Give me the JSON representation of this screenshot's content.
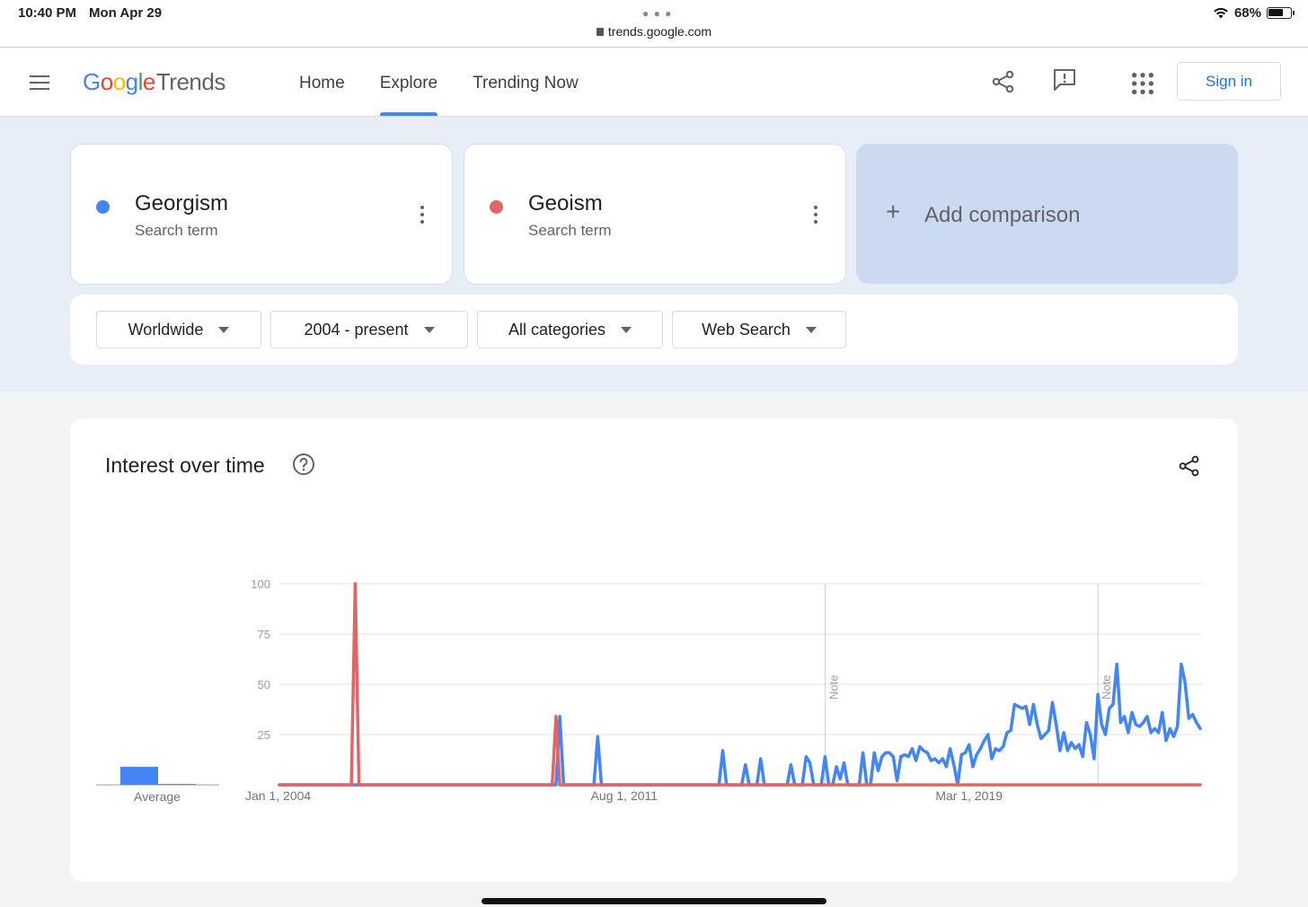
{
  "status_bar": {
    "time": "10:40 PM",
    "date": "Mon Apr 29",
    "url": "trends.google.com",
    "battery": "68%",
    "battery_level": 0.68,
    "icons": [
      "wifi-icon",
      "battery-icon",
      "lock-icon"
    ]
  },
  "header": {
    "logo_google": [
      "G",
      "o",
      "o",
      "g",
      "l",
      "e"
    ],
    "logo_colors": [
      "#4285f4",
      "#ea4335",
      "#fbbc05",
      "#4285f4",
      "#34a853",
      "#ea4335"
    ],
    "logo_trends": "Trends",
    "nav": [
      {
        "label": "Home",
        "active": false
      },
      {
        "label": "Explore",
        "active": true
      },
      {
        "label": "Trending Now",
        "active": false
      }
    ],
    "icons": [
      "menu-icon",
      "share-icon",
      "feedback-icon",
      "apps-grid-icon"
    ],
    "sign_in": "Sign in"
  },
  "terms": [
    {
      "name": "Georgism",
      "sub": "Search term",
      "color": "#4285f4"
    },
    {
      "name": "Geoism",
      "sub": "Search term",
      "color": "#e06666"
    }
  ],
  "add_comparison": {
    "plus": "+",
    "label": "Add comparison"
  },
  "filters": [
    {
      "label": "Worldwide"
    },
    {
      "label": "2004 - present"
    },
    {
      "label": "All categories"
    },
    {
      "label": "Web Search"
    }
  ],
  "interest_over_time": {
    "title": "Interest over time",
    "icons": [
      "help-icon",
      "share-icon"
    ]
  },
  "chart_data": {
    "type": "line",
    "title": "Interest over time",
    "ylim": [
      0,
      100
    ],
    "y_ticks": [
      "100",
      "75",
      "50",
      "25"
    ],
    "x_ticks": [
      "Jan 1, 2004",
      "Aug 1, 2011",
      "Mar 1, 2019"
    ],
    "x_range": [
      "2004-01",
      "2024-04"
    ],
    "notes": [
      {
        "date": "2016-01",
        "label": "Note"
      },
      {
        "date": "2022-01",
        "label": "Note"
      }
    ],
    "average_label": "Average",
    "averages": [
      {
        "name": "Georgism",
        "value": 9,
        "color": "#4285f4"
      },
      {
        "name": "Geoism",
        "value": 0.5,
        "color": "#e06666"
      }
    ],
    "grid": true,
    "series": [
      {
        "name": "Georgism",
        "color": "#4285f4",
        "points": [
          [
            "2004-01",
            0
          ],
          [
            "2010-02",
            0
          ],
          [
            "2010-03",
            34
          ],
          [
            "2010-04",
            0
          ],
          [
            "2010-12",
            0
          ],
          [
            "2011-01",
            24
          ],
          [
            "2011-02",
            0
          ],
          [
            "2013-09",
            0
          ],
          [
            "2013-10",
            17
          ],
          [
            "2013-11",
            0
          ],
          [
            "2014-03",
            0
          ],
          [
            "2014-04",
            10
          ],
          [
            "2014-05",
            0
          ],
          [
            "2014-07",
            0
          ],
          [
            "2014-08",
            13
          ],
          [
            "2014-09",
            0
          ],
          [
            "2015-03",
            0
          ],
          [
            "2015-04",
            10
          ],
          [
            "2015-05",
            0
          ],
          [
            "2015-07",
            0
          ],
          [
            "2015-08",
            14
          ],
          [
            "2015-09",
            11
          ],
          [
            "2015-10",
            0
          ],
          [
            "2015-12",
            0
          ],
          [
            "2016-01",
            14
          ],
          [
            "2016-02",
            0
          ],
          [
            "2016-03",
            0
          ],
          [
            "2016-04",
            9
          ],
          [
            "2016-05",
            3
          ],
          [
            "2016-06",
            11
          ],
          [
            "2016-07",
            0
          ],
          [
            "2016-10",
            0
          ],
          [
            "2016-11",
            16
          ],
          [
            "2016-12",
            0
          ],
          [
            "2017-01",
            0
          ],
          [
            "2017-02",
            16
          ],
          [
            "2017-03",
            7
          ],
          [
            "2017-04",
            14
          ],
          [
            "2017-05",
            16
          ],
          [
            "2017-06",
            16
          ],
          [
            "2017-07",
            14
          ],
          [
            "2017-08",
            2
          ],
          [
            "2017-09",
            14
          ],
          [
            "2017-10",
            15
          ],
          [
            "2017-11",
            14
          ],
          [
            "2017-12",
            18
          ],
          [
            "2018-01",
            12
          ],
          [
            "2018-02",
            19
          ],
          [
            "2018-03",
            17
          ],
          [
            "2018-04",
            16
          ],
          [
            "2018-05",
            12
          ],
          [
            "2018-06",
            13
          ],
          [
            "2018-07",
            11
          ],
          [
            "2018-08",
            13
          ],
          [
            "2018-09",
            9
          ],
          [
            "2018-10",
            18
          ],
          [
            "2018-11",
            10
          ],
          [
            "2018-12",
            0
          ],
          [
            "2019-01",
            15
          ],
          [
            "2019-02",
            16
          ],
          [
            "2019-03",
            20
          ],
          [
            "2019-04",
            9
          ],
          [
            "2019-05",
            15
          ],
          [
            "2019-06",
            18
          ],
          [
            "2019-07",
            22
          ],
          [
            "2019-08",
            25
          ],
          [
            "2019-09",
            13
          ],
          [
            "2019-10",
            18
          ],
          [
            "2019-11",
            17
          ],
          [
            "2019-12",
            19
          ],
          [
            "2020-01",
            26
          ],
          [
            "2020-02",
            27
          ],
          [
            "2020-03",
            40
          ],
          [
            "2020-04",
            39
          ],
          [
            "2020-05",
            38
          ],
          [
            "2020-06",
            39
          ],
          [
            "2020-07",
            30
          ],
          [
            "2020-08",
            40
          ],
          [
            "2020-09",
            30
          ],
          [
            "2020-10",
            23
          ],
          [
            "2020-11",
            25
          ],
          [
            "2020-12",
            27
          ],
          [
            "2021-01",
            41
          ],
          [
            "2021-02",
            30
          ],
          [
            "2021-03",
            17
          ],
          [
            "2021-04",
            26
          ],
          [
            "2021-05",
            17
          ],
          [
            "2021-06",
            21
          ],
          [
            "2021-07",
            18
          ],
          [
            "2021-08",
            20
          ],
          [
            "2021-09",
            14
          ],
          [
            "2021-10",
            31
          ],
          [
            "2021-11",
            25
          ],
          [
            "2021-12",
            13
          ],
          [
            "2022-01",
            45
          ],
          [
            "2022-02",
            30
          ],
          [
            "2022-03",
            25
          ],
          [
            "2022-04",
            38
          ],
          [
            "2022-05",
            40
          ],
          [
            "2022-06",
            60
          ],
          [
            "2022-07",
            31
          ],
          [
            "2022-08",
            34
          ],
          [
            "2022-09",
            26
          ],
          [
            "2022-10",
            36
          ],
          [
            "2022-11",
            30
          ],
          [
            "2022-12",
            29
          ],
          [
            "2023-01",
            31
          ],
          [
            "2023-02",
            34
          ],
          [
            "2023-03",
            26
          ],
          [
            "2023-04",
            28
          ],
          [
            "2023-05",
            26
          ],
          [
            "2023-06",
            36
          ],
          [
            "2023-07",
            22
          ],
          [
            "2023-08",
            28
          ],
          [
            "2023-09",
            24
          ],
          [
            "2023-10",
            29
          ],
          [
            "2023-11",
            60
          ],
          [
            "2023-12",
            51
          ],
          [
            "2024-01",
            33
          ],
          [
            "2024-02",
            35
          ],
          [
            "2024-03",
            31
          ],
          [
            "2024-04",
            28
          ]
        ]
      },
      {
        "name": "Geoism",
        "color": "#e06666",
        "points": [
          [
            "2004-01",
            0
          ],
          [
            "2005-08",
            0
          ],
          [
            "2005-09",
            100
          ],
          [
            "2005-10",
            0
          ],
          [
            "2010-01",
            0
          ],
          [
            "2010-02",
            34
          ],
          [
            "2010-03",
            0
          ],
          [
            "2024-04",
            0
          ]
        ]
      }
    ]
  }
}
